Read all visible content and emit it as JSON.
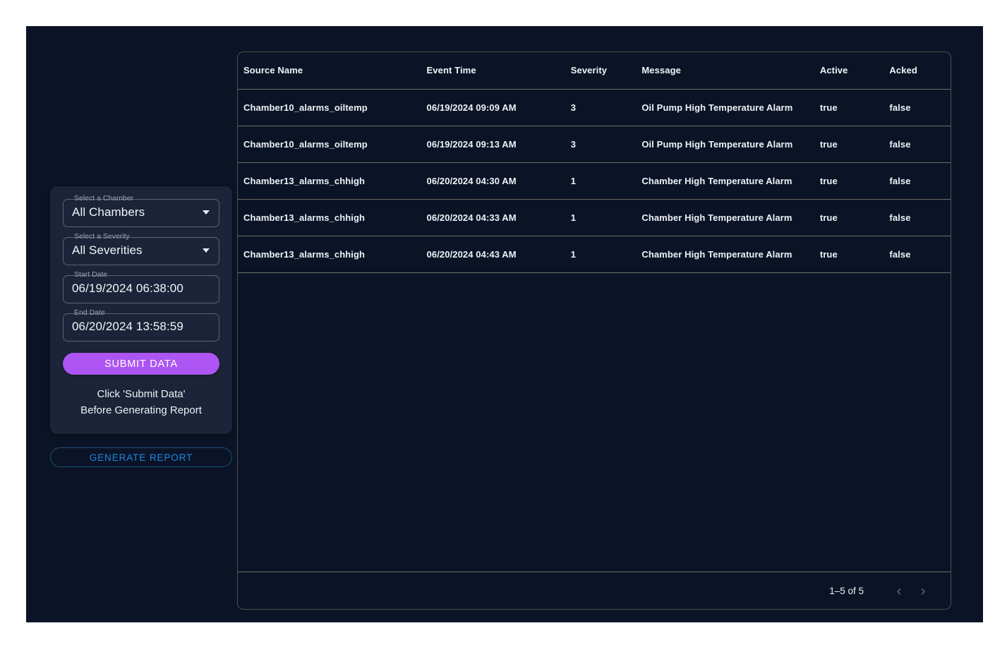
{
  "filters": {
    "chamber": {
      "label": "Select a Chamber",
      "value": "All Chambers",
      "arrow_icon": "chevron-down-icon"
    },
    "severity": {
      "label": "Select a Severity",
      "value": "All Severities",
      "arrow_icon": "chevron-down-icon"
    },
    "start_date": {
      "label": "Start Date",
      "value": "06/19/2024 06:38:00"
    },
    "end_date": {
      "label": "End Date",
      "value": "06/20/2024 13:58:59"
    },
    "submit_label": "SUBMIT DATA",
    "hint_line1": "Click 'Submit Data'",
    "hint_line2": "Before Generating Report",
    "generate_report_label": "GENERATE REPORT"
  },
  "table": {
    "columns": [
      "Source Name",
      "Event Time",
      "Severity",
      "Message",
      "Active",
      "Acked"
    ],
    "rows": [
      {
        "source_name": "Chamber10_alarms_oiltemp",
        "event_time": "06/19/2024 09:09 AM",
        "severity": "3",
        "message": "Oil Pump High Temperature Alarm",
        "active": "true",
        "acked": "false"
      },
      {
        "source_name": "Chamber10_alarms_oiltemp",
        "event_time": "06/19/2024 09:13 AM",
        "severity": "3",
        "message": "Oil Pump High Temperature Alarm",
        "active": "true",
        "acked": "false"
      },
      {
        "source_name": "Chamber13_alarms_chhigh",
        "event_time": "06/20/2024 04:30 AM",
        "severity": "1",
        "message": "Chamber High Temperature Alarm",
        "active": "true",
        "acked": "false"
      },
      {
        "source_name": "Chamber13_alarms_chhigh",
        "event_time": "06/20/2024 04:33 AM",
        "severity": "1",
        "message": "Chamber High Temperature Alarm",
        "active": "true",
        "acked": "false"
      },
      {
        "source_name": "Chamber13_alarms_chhigh",
        "event_time": "06/20/2024 04:43 AM",
        "severity": "1",
        "message": "Chamber High Temperature Alarm",
        "active": "true",
        "acked": "false"
      }
    ],
    "pagination": {
      "range_label": "1–5 of 5",
      "prev_icon": "chevron-left-icon",
      "prev_glyph": "‹",
      "next_icon": "chevron-right-icon",
      "next_glyph": "›"
    }
  },
  "colors": {
    "page_background": "#ffffff",
    "panel_background": "#0b1426",
    "card_background": "#1b2438",
    "submit_button": "#ad55f2",
    "generate_report_text": "#1e88e5",
    "generate_report_border": "#1d4f7a",
    "table_border": "#4d4d4d",
    "row_divider": "#6e6e62",
    "field_outline": "#59647a",
    "field_label_text": "#9aa4b8",
    "primary_text": "#eef1f7",
    "pager_disabled": "#5c6575"
  }
}
